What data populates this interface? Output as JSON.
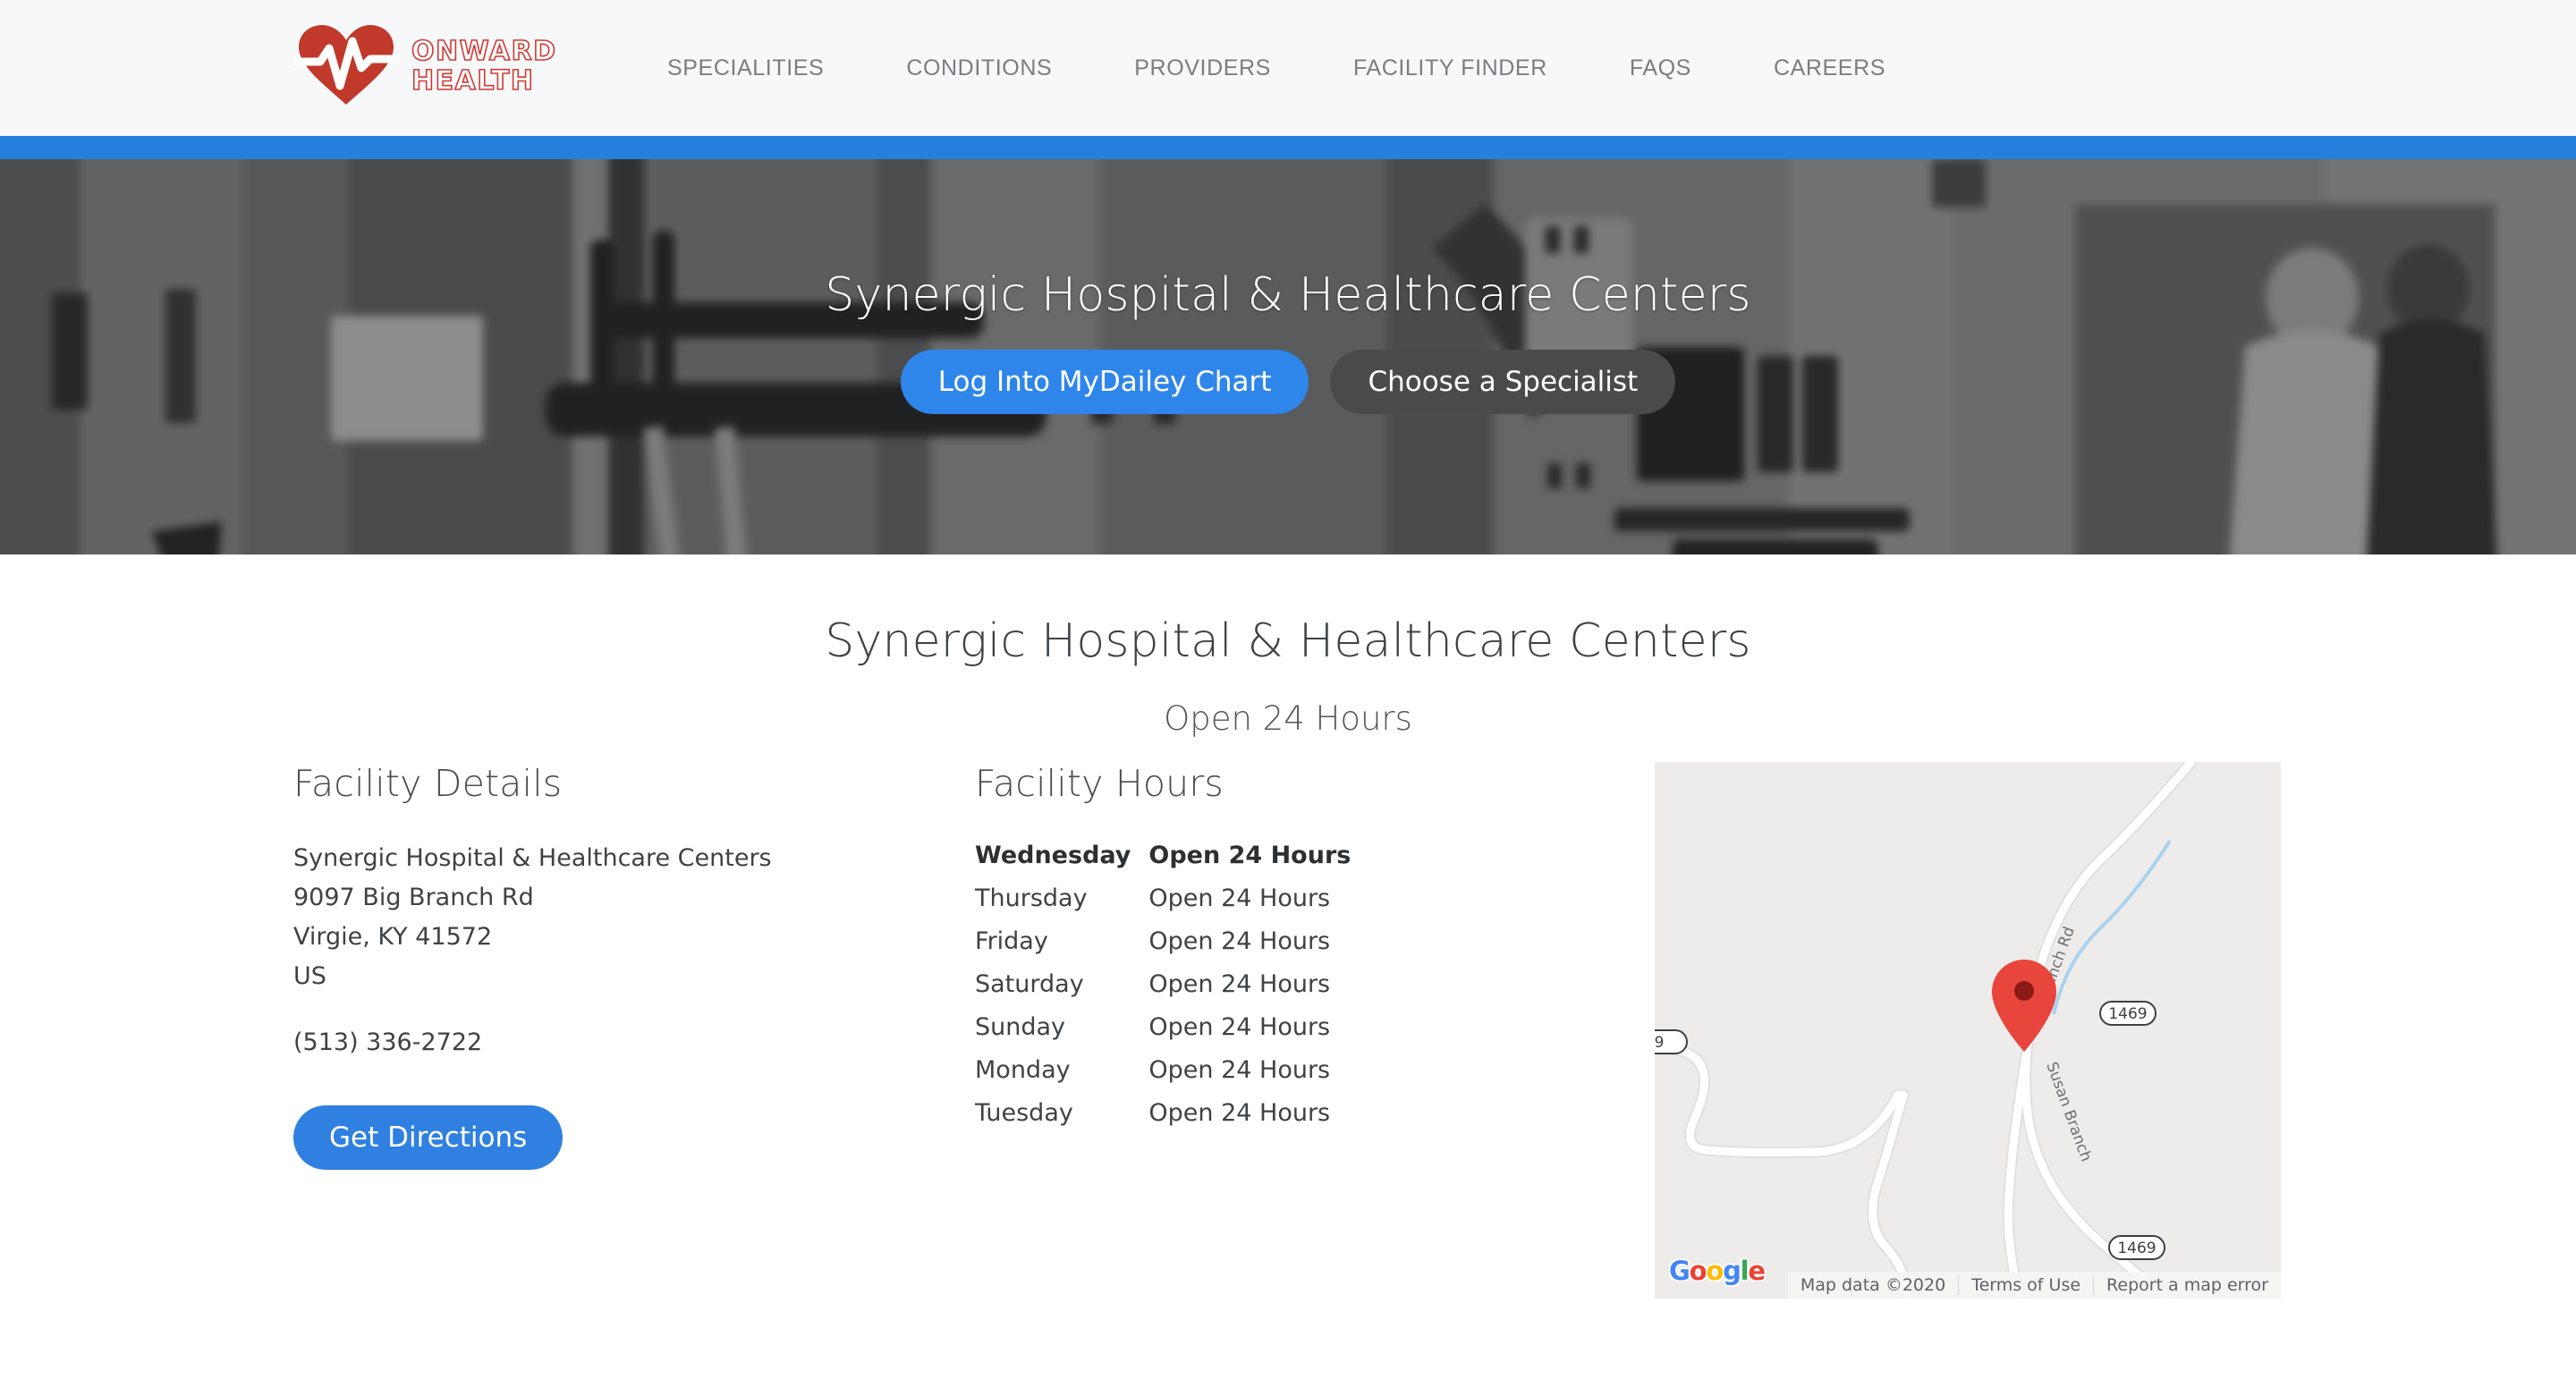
{
  "header": {
    "logo": {
      "icon": "heart-pulse-icon",
      "line1": "ONWARD",
      "line2": "HEALTH",
      "heart_color": "#c0392b",
      "wordmark_outline_color": "#cf3b36"
    },
    "nav": [
      {
        "label": "SPECIALITIES"
      },
      {
        "label": "CONDITIONS"
      },
      {
        "label": "PROVIDERS"
      },
      {
        "label": "FACILITY FINDER"
      },
      {
        "label": "FAQS"
      },
      {
        "label": "CAREERS"
      }
    ],
    "accent_bar_color": "#2680db",
    "background_color": "#f7f8f9"
  },
  "hero": {
    "title": "Synergic Hospital & Healthcare Centers",
    "primary_button": "Log Into MyDailey Chart",
    "secondary_button": "Choose a Specialist",
    "primary_button_color": "#2f86ea",
    "secondary_button_color": "#484a4c",
    "image_description": "blurred grayscale hospital corridor with staff walking and a hospital bed"
  },
  "main": {
    "title": "Synergic Hospital & Healthcare Centers",
    "subtitle": "Open 24 Hours",
    "details": {
      "heading": "Facility Details",
      "name": "Synergic Hospital & Healthcare Centers",
      "street": "9097 Big Branch Rd",
      "city_state_zip": "Virgie, KY 41572",
      "country": "US",
      "phone": "(513) 336-2722",
      "directions_button": "Get Directions",
      "directions_button_color": "#2f80e0"
    },
    "hours": {
      "heading": "Facility Hours",
      "rows": [
        {
          "day": "Wednesday",
          "hours": "Open 24 Hours",
          "today": true
        },
        {
          "day": "Thursday",
          "hours": "Open 24 Hours",
          "today": false
        },
        {
          "day": "Friday",
          "hours": "Open 24 Hours",
          "today": false
        },
        {
          "day": "Saturday",
          "hours": "Open 24 Hours",
          "today": false
        },
        {
          "day": "Sunday",
          "hours": "Open 24 Hours",
          "today": false
        },
        {
          "day": "Monday",
          "hours": "Open 24 Hours",
          "today": false
        },
        {
          "day": "Tuesday",
          "hours": "Open 24 Hours",
          "today": false
        }
      ]
    },
    "map": {
      "provider": "Google",
      "logo_letters": [
        "G",
        "o",
        "o",
        "g",
        "l",
        "e"
      ],
      "marker": "red-map-pin",
      "background_color": "#eeecea",
      "road_labels": [
        "Big Branch Rd",
        "Susan Branch"
      ],
      "route_shields": [
        "1469",
        "1469",
        "9"
      ],
      "attribution": [
        "Map data ©2020",
        "Terms of Use",
        "Report a map error"
      ]
    }
  }
}
